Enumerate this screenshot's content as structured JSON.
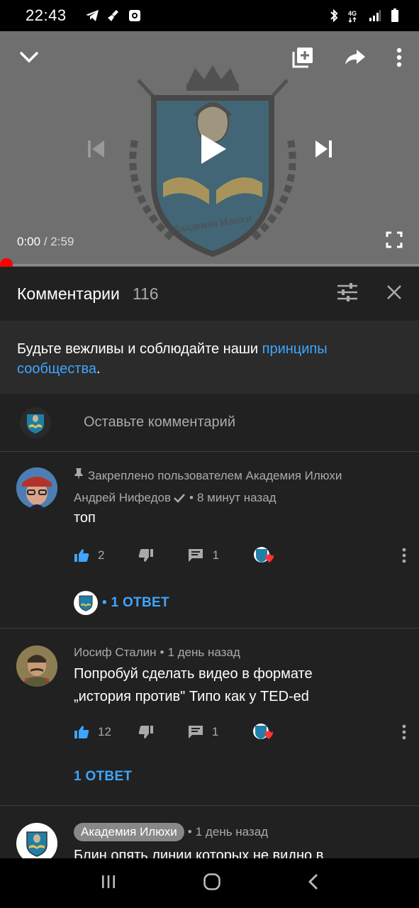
{
  "status_bar": {
    "time": "22:43",
    "icons_left": [
      "telegram-icon",
      "broom-icon",
      "square-app-icon"
    ],
    "icons_right": [
      "bluetooth-icon",
      "4g-icon",
      "signal-icon",
      "battery-icon"
    ],
    "network": "4G"
  },
  "player": {
    "current_time": "0:00",
    "separator": "/",
    "duration": "2:59",
    "logo_text": "Академия Илюхи",
    "progress": 0,
    "accent": "#ff0000"
  },
  "comments_header": {
    "title": "Комментарии",
    "count": "116"
  },
  "guidelines": {
    "text": "Будьте вежливы и соблюдайте наши ",
    "link": "принципы сообщества",
    "end": "."
  },
  "add_comment": {
    "placeholder": "Оставьте комментарий"
  },
  "comments": [
    {
      "pinned_label": "Закреплено пользователем Академия Илюхи",
      "author": "Андрей Нифедов",
      "time": "8 минут назад",
      "text": "топ",
      "likes": "2",
      "replies_count": "1",
      "reply_link": "1 ОТВЕТ"
    },
    {
      "author": "Иосиф Сталин",
      "time": "1 день назад",
      "text_line1": "Попробуй сделать видео в формате",
      "text_line2": "„история против\" Типо как у TED-ed",
      "likes": "12",
      "replies_count": "1",
      "reply_link": "1 ОТВЕТ"
    },
    {
      "author": "Академия Илюхи",
      "time": "1 день назад",
      "text": "Блин опять линии которых не видно в"
    }
  ],
  "colors": {
    "background": "#212121",
    "link": "#3ea6ff",
    "like_active": "#3ea6ff"
  }
}
